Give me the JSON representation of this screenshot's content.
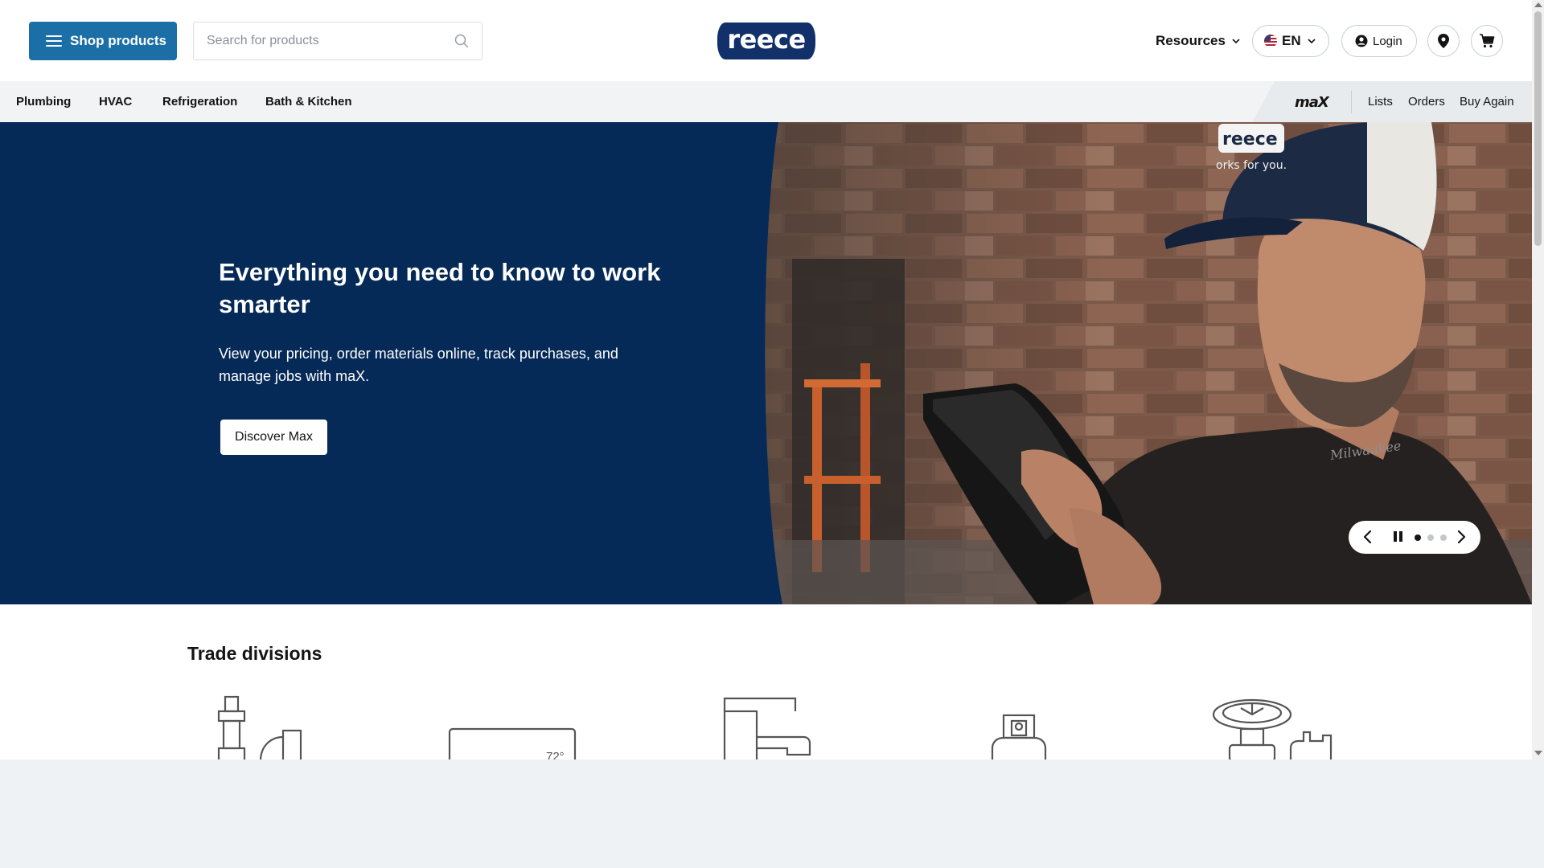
{
  "header": {
    "shop_button_label": "Shop products",
    "search_placeholder": "Search for products",
    "logo_text": "reece",
    "resources_label": "Resources",
    "language_label": "EN",
    "login_label": "Login"
  },
  "category_nav": {
    "items": [
      "Plumbing",
      "HVAC",
      "Refrigeration",
      "Bath & Kitchen"
    ],
    "max_logo": "maX",
    "links": [
      "Lists",
      "Orders",
      "Buy Again"
    ]
  },
  "hero": {
    "title": "Everything you need to know to work smarter",
    "subtitle": "View your pricing, order materials online, track purchases, and manage jobs with maX.",
    "cta_label": "Discover Max",
    "cap_text": "reece",
    "shirt_text": "orks for you.",
    "carousel": {
      "slide_count": 3,
      "active_index": 0
    }
  },
  "trade_divisions": {
    "title": "Trade divisions",
    "thermostat_reading": "72°"
  },
  "colors": {
    "brand_navy": "#062a57",
    "shop_button": "#1b6fa6",
    "logo_navy": "#12306a",
    "nav_bg": "#f1f3f5"
  },
  "icons": [
    "hamburger-icon",
    "search-icon",
    "chevron-down-icon",
    "us-flag-icon",
    "user-icon",
    "location-pin-icon",
    "cart-icon",
    "chevron-left-icon",
    "pause-icon",
    "chevron-right-icon",
    "plumbing-pipe-icon",
    "thermostat-icon",
    "faucet-icon",
    "refrigerant-tank-icon",
    "valve-icon"
  ]
}
